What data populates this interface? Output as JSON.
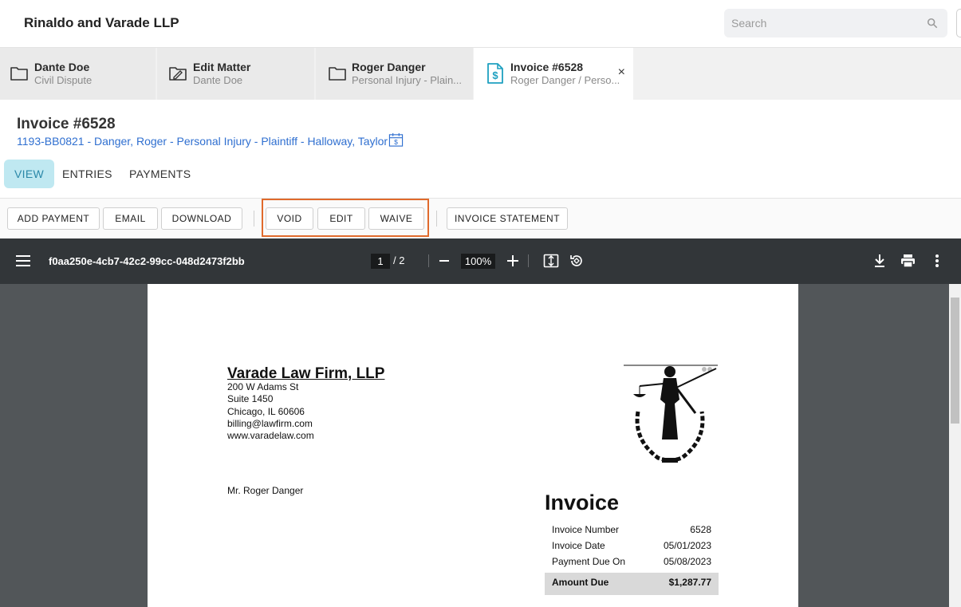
{
  "app": {
    "firm_name": "Rinaldo and Varade LLP",
    "search_placeholder": "Search"
  },
  "tabs": [
    {
      "icon": "folder-icon",
      "title": "Dante Doe",
      "subtitle": "Civil Dispute"
    },
    {
      "icon": "edit-folder-icon",
      "title": "Edit Matter",
      "subtitle": "Dante Doe"
    },
    {
      "icon": "folder-icon",
      "title": "Roger Danger",
      "subtitle": "Personal Injury - Plain..."
    },
    {
      "icon": "invoice-dollar-icon",
      "title": "Invoice #6528",
      "subtitle": "Roger Danger / Perso...",
      "active": true,
      "close": "×"
    }
  ],
  "page": {
    "title": "Invoice #6528",
    "matter_link": "1193-BB0821 - Danger, Roger - Personal Injury - Plaintiff - Halloway, Taylor"
  },
  "subtabs": [
    "VIEW",
    "ENTRIES",
    "PAYMENTS"
  ],
  "toolbar": {
    "add_payment": "ADD PAYMENT",
    "email": "EMAIL",
    "download": "DOWNLOAD",
    "void": "VOID",
    "edit": "EDIT",
    "waive": "WAIVE",
    "invoice_statement": "INVOICE STATEMENT",
    "highlight_color": "#e06a2c"
  },
  "viewer": {
    "filename": "f0aa250e-4cb7-42c2-99cc-048d2473f2bb",
    "current_page": "1",
    "page_total": "/  2",
    "zoom": "100%"
  },
  "document": {
    "firm": "Varade Law Firm, LLP",
    "address": [
      "200 W Adams St",
      "Suite 1450",
      "Chicago, IL 60606",
      "billing@lawfirm.com",
      "www.varadelaw.com"
    ],
    "client": "Mr. Roger Danger",
    "heading": "Invoice",
    "rows": [
      {
        "label": "Invoice Number",
        "value": "6528"
      },
      {
        "label": "Invoice Date",
        "value": "05/01/2023"
      },
      {
        "label": "Payment Due On",
        "value": "05/08/2023"
      }
    ],
    "amount_due_label": "Amount Due",
    "amount_due_value": "$1,287.77"
  }
}
